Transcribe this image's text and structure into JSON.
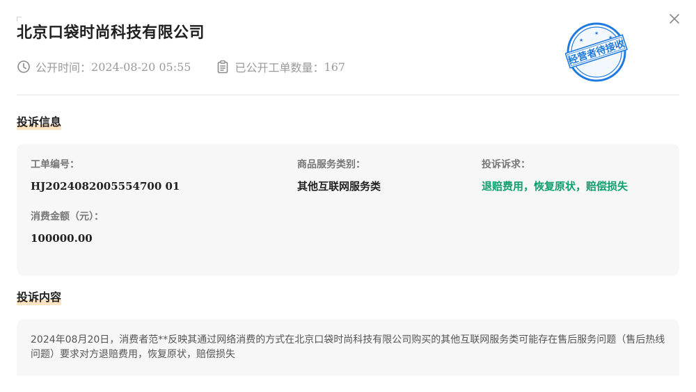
{
  "header": {
    "company_name": "北京口袋时尚科技有限公司",
    "publish_label": "公开时间",
    "publish_sep": "：",
    "publish_time": "2024-08-20 05:55",
    "count_label": "已公开工单数量",
    "count_sep": "：",
    "count_value": "167",
    "stamp_text": "经营者待接收"
  },
  "info_section": {
    "title": "投诉信息",
    "order_no_label": "工单编号：",
    "order_no_value": "HJ2024082005554700 01",
    "category_label": "商品服务类别：",
    "category_value": "其他互联网服务类",
    "demand_label": "投诉诉求：",
    "demand_value": "退赔费用，恢复原状，赔偿损失",
    "amount_label": "消费金额（元）：",
    "amount_value": "100000.00"
  },
  "content_section": {
    "title": "投诉内容",
    "text": "2024年08月20日，消费者范**反映其通过网络消费的方式在北京口袋时尚科技有限公司购买的其他互联网服务类可能存在售后服务问题（售后热线问题）要求对方退赔费用，恢复原状，赔偿损失"
  },
  "colors": {
    "accent_green": "#0e9f6e",
    "stamp_blue": "#1f7ae0",
    "title_highlight": "#fde3c0"
  },
  "icons": {
    "clock": "clock-icon",
    "clipboard": "clipboard-icon",
    "close": "close-icon"
  }
}
